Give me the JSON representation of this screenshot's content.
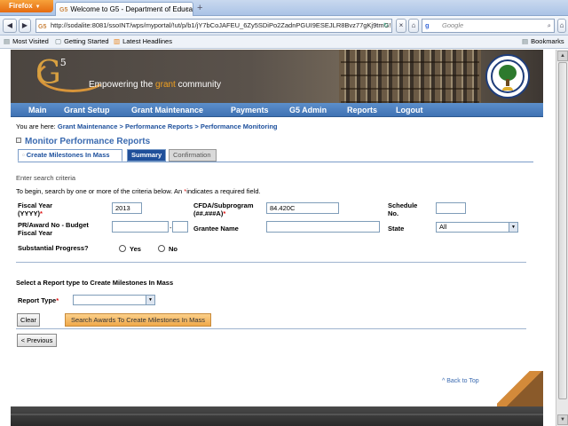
{
  "browser": {
    "firefox_label": "Firefox",
    "tab_title": "Welcome to G5 - Department of Educati...",
    "tab_favicon": "G5",
    "new_tab": "+",
    "url_favicon": "G5",
    "url": "http://sodalite:8081/ssoINT/wps/myportal/!ut/p/b1/jY7bCoJAFEU_6Zy5SDiPo2ZadnPGUI9ESEJLR8Bvz77gKj9tmG!",
    "search_placeholder": "Google",
    "search_engine_icon": "google-icon",
    "bookmarks": {
      "most_visited": "Most Visited",
      "getting_started": "Getting Started",
      "latest_headlines": "Latest Headlines",
      "bookmarks": "Bookmarks"
    }
  },
  "banner": {
    "logo": "G",
    "logo_sup": "5",
    "tagline_pre": "Empowering the ",
    "tagline_hl": "grant",
    "tagline_post": " community"
  },
  "menu": [
    "Main",
    "Grant Setup",
    "Grant Maintenance",
    "Payments",
    "G5 Admin",
    "Reports",
    "Logout"
  ],
  "breadcrumb": {
    "prefix": "You are here:",
    "items": [
      "Grant Maintenance",
      "Performance Reports",
      "Performance Monitoring"
    ],
    "sep": ">"
  },
  "page_title": "Monitor Performance Reports",
  "tabs": [
    "Create Milestones In Mass",
    "Summary",
    "Confirmation"
  ],
  "form": {
    "section_label": "Enter search criteria",
    "instructions_pre": "To begin, search by one or more of the criteria below.   An ",
    "instructions_req": "*",
    "instructions_post": "indicates a required field.",
    "fiscal_year_label1": "Fiscal Year",
    "fiscal_year_label2": "(YYYY)",
    "fiscal_year_value": "2013",
    "cfda_label1": "CFDA/Subprogram",
    "cfda_label2": "(##.###A)",
    "cfda_value": "84.420C",
    "schedule_label1": "Schedule",
    "schedule_label2": "No.",
    "schedule_value": "",
    "pr_award_label1": "PR/Award No - Budget",
    "pr_award_label2": "Fiscal Year",
    "pr_award_dash": "-",
    "grantee_label": "Grantee Name",
    "state_label": "State",
    "state_value": "All",
    "substantial_label": "Substantial Progress?",
    "yes": "Yes",
    "no": "No",
    "report_section": "Select a Report type to Create Milestones In Mass",
    "report_type_label": "Report Type",
    "report_type_value": "",
    "required": "*",
    "clear_btn": "Clear",
    "search_btn": "Search Awards To Create Milestones In Mass",
    "previous_btn": "< Previous",
    "back_to_top": "^ Back to Top"
  }
}
